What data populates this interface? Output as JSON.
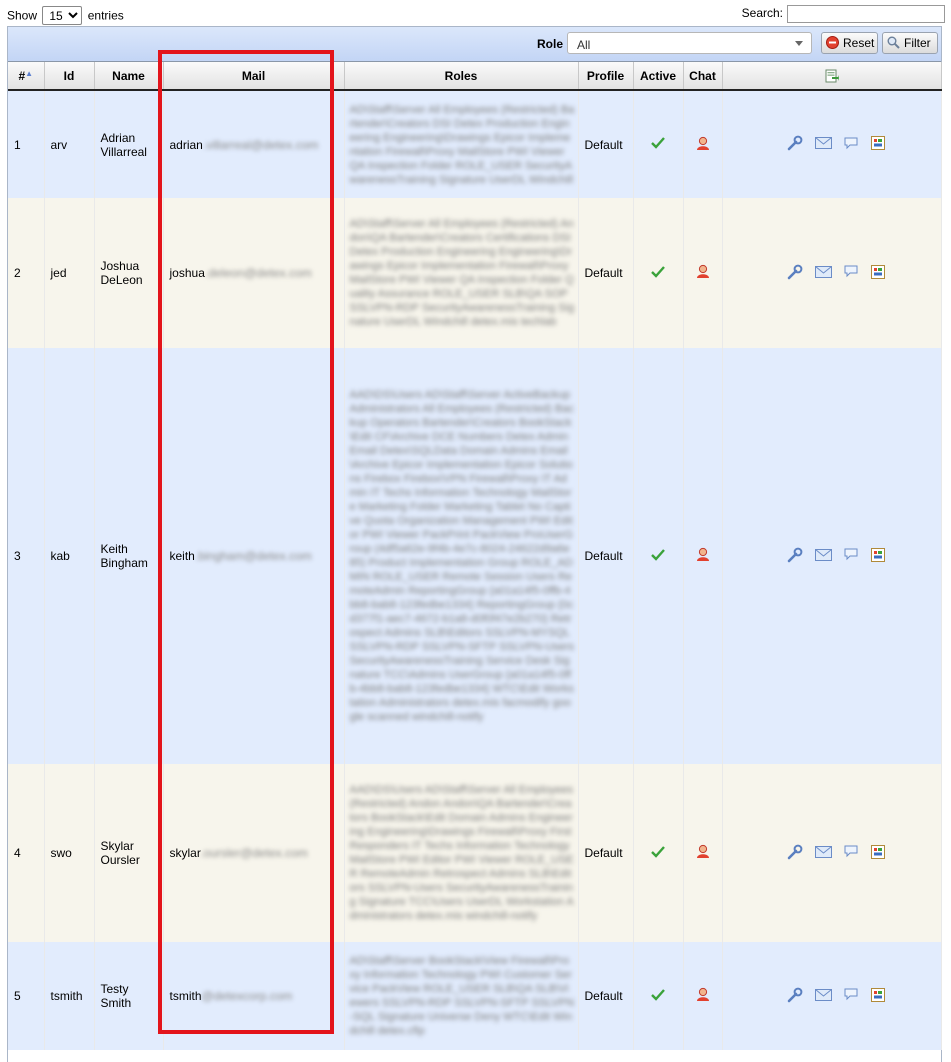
{
  "length_menu": {
    "prefix": "Show",
    "value": "15",
    "suffix": "entries"
  },
  "search": {
    "label": "Search:",
    "value": ""
  },
  "filter_bar": {
    "role_label": "Role",
    "role_value": "All",
    "reset_label": "Reset",
    "filter_label": "Filter"
  },
  "columns": [
    "#",
    "Id",
    "Name",
    "Mail",
    "Roles",
    "Profile",
    "Active",
    "Chat"
  ],
  "rows": [
    {
      "num": "1",
      "id": "arv",
      "name": "Adrian Villarreal",
      "mail_user": "adrian",
      "mail_domain": ".villarreal@detex.com",
      "roles": "AD\\Staff\\Server All Employees (Restricted) Bartender\\Creators DSI Detex Production Engineering Engineering\\Drawings Epicor Implementation Firewall\\Proxy MailStore PWI Viewer QA Inspection Folder ROLE_USER SecurityAwarenessTraining Signature UserDL Windchill",
      "profile": "Default"
    },
    {
      "num": "2",
      "id": "jed",
      "name": "Joshua DeLeon",
      "mail_user": "joshua",
      "mail_domain": ".deleon@detex.com",
      "roles": "AD\\Staff\\Server All Employees (Restricted) Andon\\QA Bartender\\Creators Certifications DSI Detex Production Engineering Engineering\\Drawings Epicor Implementation Firewall\\Proxy MailStore PWI Viewer QA Inspection Folder Quality Assurance ROLE_USER SLB\\QA SOP SSLVPN-RDP SecurityAwarenessTraining Signature UserDL Windchill detex.mis techlab",
      "profile": "Default"
    },
    {
      "num": "3",
      "id": "kab",
      "name": "Keith Bingham",
      "mail_user": "keith",
      "mail_domain": ".bingham@detex.com",
      "roles": "AAD\\DS\\Users AD\\Staff\\Server ActiveBackup Administrators All Employees (Restricted) Backup Operators Bartender\\Creators BookStack\\Edit CF\\Archive DCE Numbers Detex Admin Email Detex\\SQLData Domain Admins Email\\Archive Epicor Implementation Epicor Solutions Firebox Firebox\\VPN Firewall\\Proxy IT Admin IT Techs Information Technology MailStore Marketing Folder Marketing Tablet No Captive Quota Organization Management PWI Editor PWI Viewer PackPrint PackView ProUserGroup (4df5a62e-9f4b-4e7c-8024-24622d9a6e85) Product Implementation Group ROLE_ADMIN ROLE_USER Remote Session Users RemoteAdmin ReportingGroup {a01a14f5-0ffb-4bb8-bab8-123fedbe1334} ReportingGroup {0cd377f1-aec7-4672-b1a8-d0f0f47e2b270} Retrospect Admins SLB\\Editors SSLVPN-MYSQL SSLVPN-RDP SSLVPN-SFTP SSLVPN-Users SecurityAwarenessTraining Service Desk Signature TCC\\Admins UserGroup {a01a14f5-0ffb-4bb8-bab8-123fedbe1334} WTC\\Edit Workstation Administrators detex.mis facmodify google scanned windchill-notify",
      "profile": "Default"
    },
    {
      "num": "4",
      "id": "swo",
      "name": "Skylar Oursler",
      "mail_user": "skylar",
      "mail_domain": ".oursler@detex.com",
      "roles": "AAD\\DS\\Users AD\\Staff\\Server All Employees (Restricted) Andon Andon\\QA Bartender\\Creators BookStack\\Edit Domain Admins Engineering Engineering\\Drawings Firewall\\Proxy First Responders IT Techs Information Technology MailStore PWI Editor PWI Viewer ROLE_USER RemoteAdmin Retrospect Admins SLB\\Editors SSLVPN-Users SecurityAwarenessTraining Signature TCC\\Users UserDL Workstation Administrators detex.mis windchill-notify",
      "profile": "Default"
    },
    {
      "num": "5",
      "id": "tsmith",
      "name": "Testy Smith",
      "mail_user": "tsmith",
      "mail_domain": "@detexcorp.com",
      "roles": "AD\\Staff\\Server BookStack\\View Firewall\\Proxy Information Technology PWI Customer Service PackView ROLE_USER SLB\\QA SLB\\Viewers SSLVPN-RDP SSLVPN-SFTP SSLVPN-SQL Signature Universe Deny WTC\\Edit Windchill detex.cfip",
      "profile": "Default"
    }
  ],
  "icons": {
    "export": "export-icon",
    "active": "checkmark-icon",
    "chat": "user-chat-icon",
    "edit": "wrench-icon",
    "mail": "envelope-icon",
    "message": "speech-bubble-icon",
    "report": "report-icon"
  },
  "colors": {
    "odd_row": "#e2ecfd",
    "even_row": "#f7f5ec",
    "header_bar": "#c3d5f5",
    "highlight": "#e3141b",
    "check": "#3aa23a"
  }
}
